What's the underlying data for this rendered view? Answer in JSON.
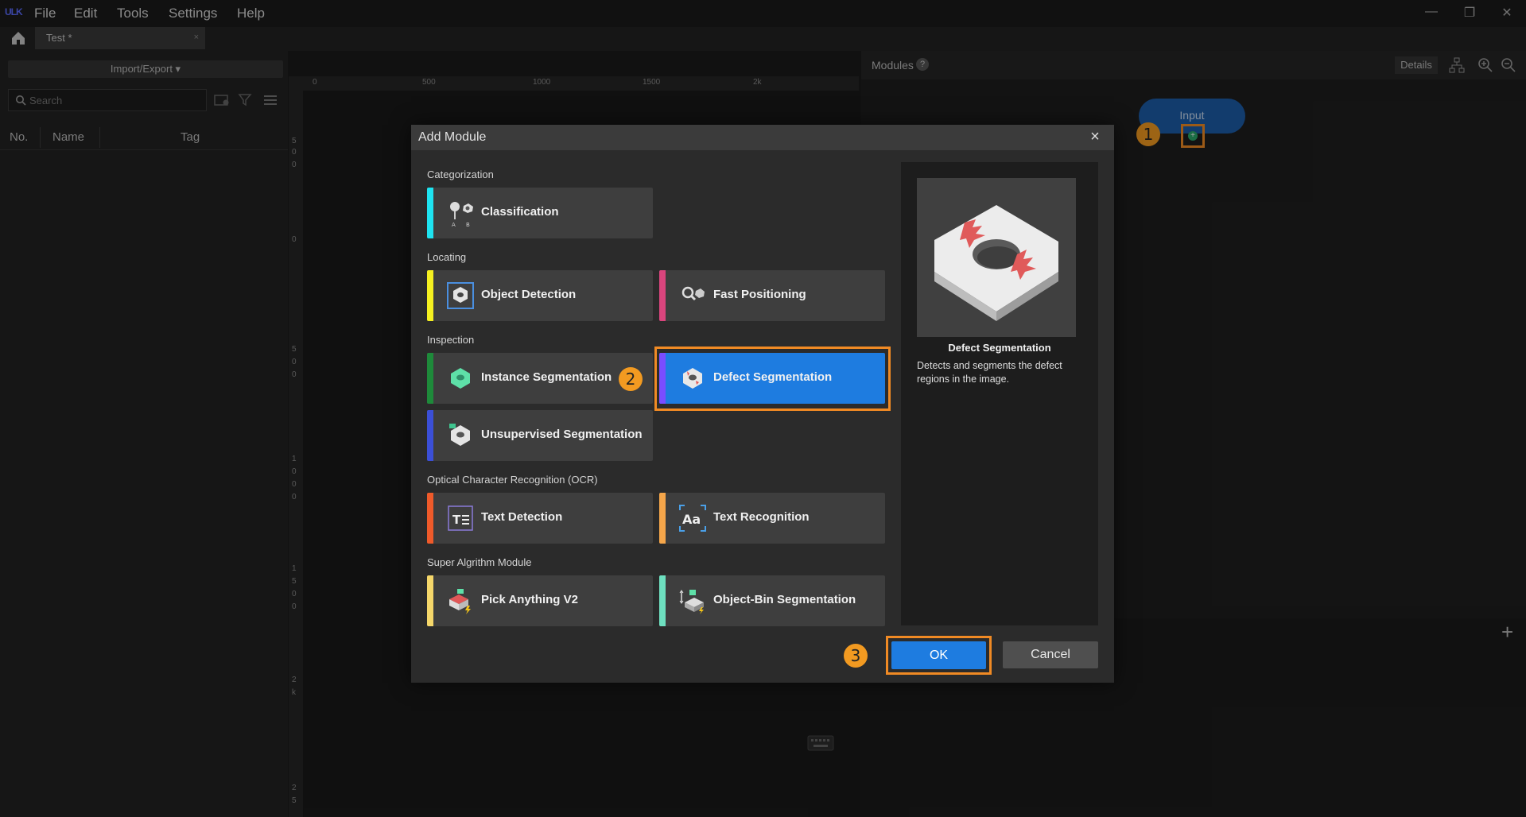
{
  "app": {
    "logo": "ULK",
    "menu": [
      "File",
      "Edit",
      "Tools",
      "Settings",
      "Help"
    ],
    "window_controls": [
      "minimize-icon",
      "restore-icon",
      "close-icon"
    ]
  },
  "tabs": [
    {
      "label": "Test *",
      "close": "×"
    }
  ],
  "left_panel": {
    "import_export_label": "Import/Export ▾",
    "search_placeholder": "Search",
    "columns": [
      "No.",
      "Name",
      "Tag"
    ]
  },
  "ruler": {
    "horizontal_ticks": [
      "0",
      "500",
      "1000",
      "1500",
      "2k"
    ],
    "vertical_ticks": [
      "5",
      "0",
      "0",
      "0",
      "5",
      "0",
      "0",
      "1",
      "0",
      "0",
      "0",
      "1",
      "5",
      "0",
      "0",
      "2",
      "k",
      "2",
      "5"
    ]
  },
  "modules_panel": {
    "title": "Modules",
    "help": "?",
    "details_label": "Details",
    "input_node_label": "Input",
    "add_symbol": "+"
  },
  "badges": [
    "1",
    "2",
    "3"
  ],
  "dialog": {
    "title": "Add Module",
    "close": "×",
    "categories": [
      {
        "label": "Categorization",
        "modules": [
          {
            "label": "Classification",
            "color": "#1ee3f0",
            "icon": "classification-icon"
          }
        ]
      },
      {
        "label": "Locating",
        "modules": [
          {
            "label": "Object Detection",
            "color": "#f5f020",
            "icon": "object-detection-icon"
          },
          {
            "label": "Fast Positioning",
            "color": "#d9457d",
            "icon": "fast-positioning-icon"
          }
        ]
      },
      {
        "label": "Inspection",
        "modules": [
          {
            "label": "Instance Segmentation",
            "color": "#1e8a3a",
            "icon": "instance-segmentation-icon"
          },
          {
            "label": "Defect Segmentation",
            "color": "#7a4dff",
            "icon": "defect-segmentation-icon",
            "selected": true
          },
          {
            "label": "Unsupervised Segmentation",
            "color": "#3b4fd6",
            "icon": "unsupervised-segmentation-icon"
          }
        ]
      },
      {
        "label": "Optical Character Recognition (OCR)",
        "modules": [
          {
            "label": "Text Detection",
            "color": "#ef5a2a",
            "icon": "text-detection-icon"
          },
          {
            "label": "Text Recognition",
            "color": "#f5a64a",
            "icon": "text-recognition-icon"
          }
        ]
      },
      {
        "label": "Super Algrithm Module",
        "modules": [
          {
            "label": "Pick Anything V2",
            "color": "#f5d76a",
            "icon": "pick-anything-icon"
          },
          {
            "label": "Object-Bin Segmentation",
            "color": "#6ee0c0",
            "icon": "object-bin-segmentation-icon"
          }
        ]
      }
    ],
    "preview": {
      "title": "Defect Segmentation",
      "description": "Detects and segments the defect regions in the image."
    },
    "ok_label": "OK",
    "cancel_label": "Cancel"
  }
}
